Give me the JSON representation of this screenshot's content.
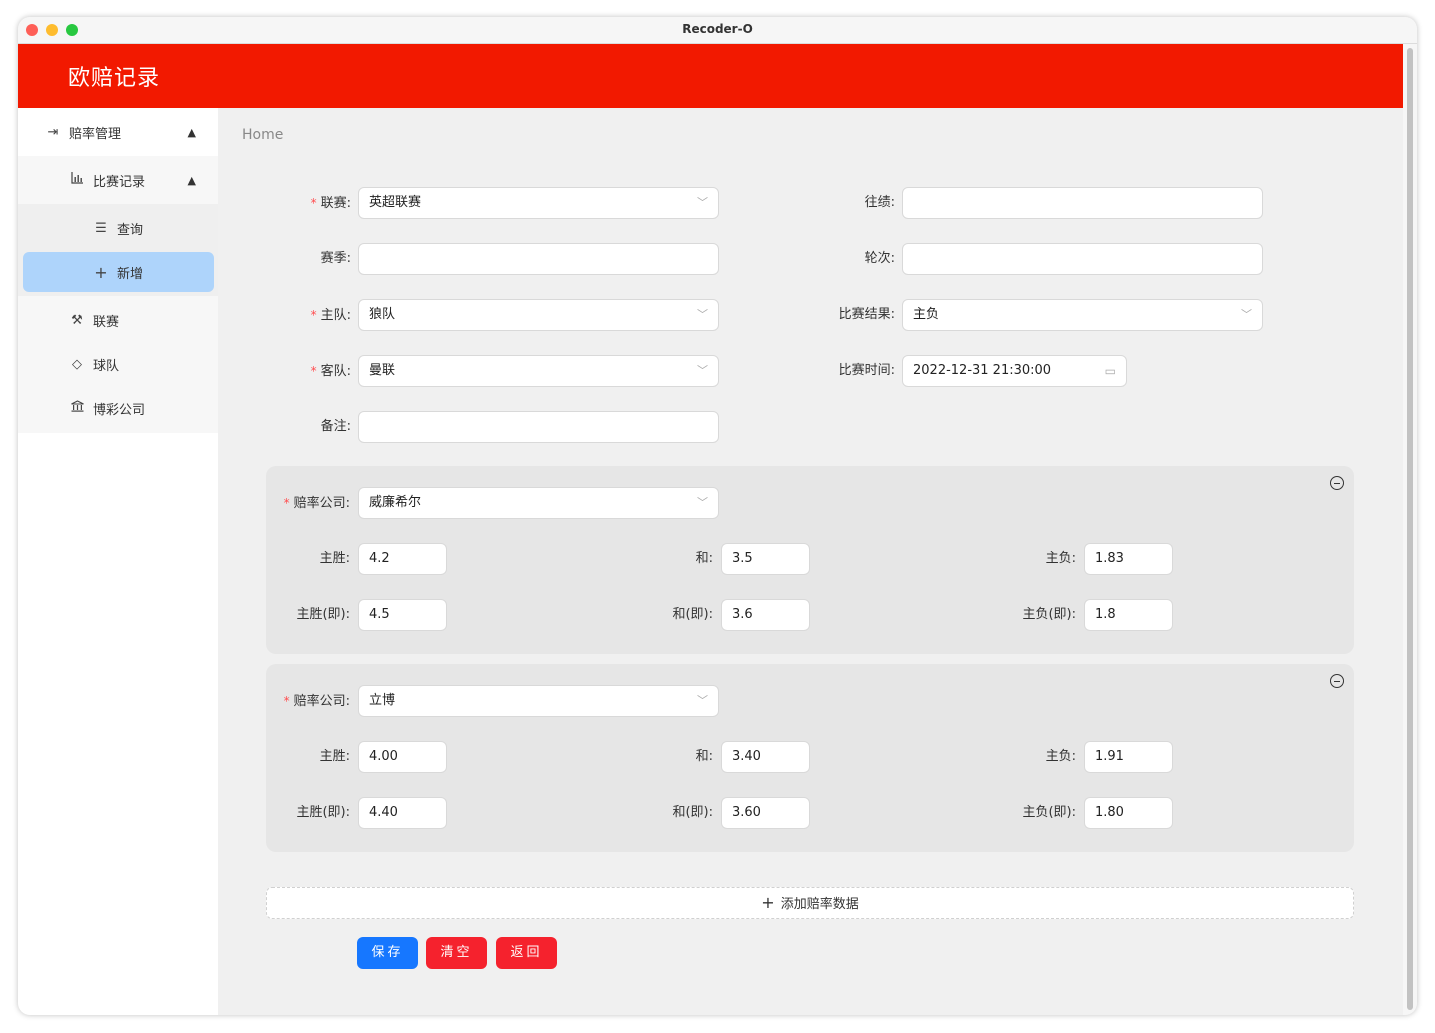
{
  "window": {
    "title": "Recoder-O"
  },
  "header": {
    "title": "欧赔记录"
  },
  "sidebar": {
    "odds_management": {
      "label": "赔率管理",
      "icon": "login-icon"
    },
    "match_records": {
      "label": "比赛记录",
      "icon": "bar-chart-icon"
    },
    "query": {
      "label": "查询",
      "icon": "list-icon"
    },
    "add_new": {
      "label": "新增",
      "icon": "plus-icon"
    },
    "league": {
      "label": "联赛",
      "icon": "tool-icon"
    },
    "team": {
      "label": "球队",
      "icon": "tag-icon"
    },
    "bookmaker": {
      "label": "博彩公司",
      "icon": "bank-icon"
    }
  },
  "breadcrumb": "Home",
  "form": {
    "league": {
      "label": "联赛",
      "value": "英超联赛"
    },
    "history": {
      "label": "往绩",
      "value": ""
    },
    "season": {
      "label": "赛季",
      "value": ""
    },
    "round": {
      "label": "轮次",
      "value": ""
    },
    "home_team": {
      "label": "主队",
      "value": "狼队"
    },
    "result": {
      "label": "比赛结果",
      "value": "主负"
    },
    "away_team": {
      "label": "客队",
      "value": "曼联"
    },
    "match_time": {
      "label": "比赛时间",
      "value": "2022-12-31 21:30:00"
    },
    "remark": {
      "label": "备注",
      "value": ""
    }
  },
  "odds_labels": {
    "company": "赔率公司",
    "home_win": "主胜",
    "draw": "和",
    "home_loss": "主负",
    "home_win_live": "主胜(即)",
    "draw_live": "和(即)",
    "home_loss_live": "主负(即)"
  },
  "odds": [
    {
      "company": "威廉希尔",
      "home_win": "4.2",
      "draw": "3.5",
      "home_loss": "1.83",
      "home_win_live": "4.5",
      "draw_live": "3.6",
      "home_loss_live": "1.8"
    },
    {
      "company": "立博",
      "home_win": "4.00",
      "draw": "3.40",
      "home_loss": "1.91",
      "home_win_live": "4.40",
      "draw_live": "3.60",
      "home_loss_live": "1.80"
    }
  ],
  "actions": {
    "add_odds": "添加赔率数据",
    "save": "保存",
    "clear": "清空",
    "back": "返回"
  },
  "colors": {
    "header": "#f21900",
    "primary": "#1677ff",
    "danger": "#f5222d",
    "active_menu": "#aed4fb"
  }
}
